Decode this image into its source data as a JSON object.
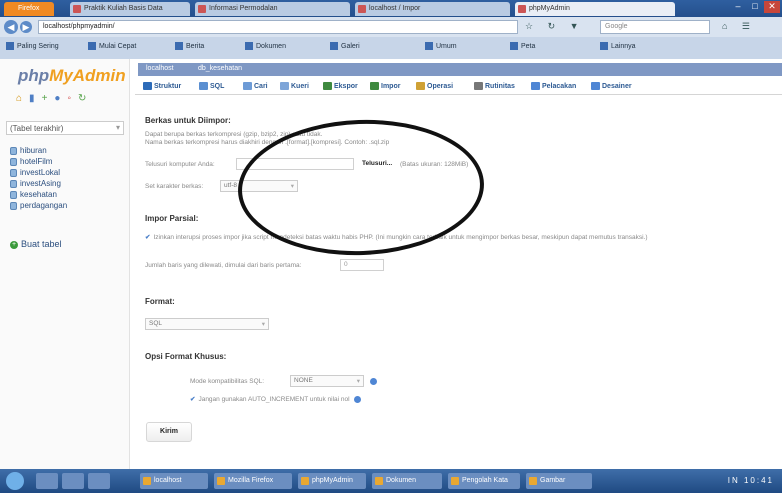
{
  "browser": {
    "tabs": [
      {
        "label": "Firefox",
        "style": "orange"
      },
      {
        "label": "Praktik Kuliah Basis Data",
        "style": "normal"
      },
      {
        "label": "Informasi Permodalan",
        "style": "normal"
      },
      {
        "label": "localhost / Impor",
        "style": "normal"
      },
      {
        "label": "phpMyAdmin",
        "style": "active"
      }
    ],
    "url": "localhost/phpmyadmin/",
    "search_placeholder": "Google",
    "bookmarks": [
      "Paling Sering",
      "Mulai Cepat",
      "Berita",
      "Dokumen",
      "Galeri",
      "Umum",
      "Peta",
      "Lainnya"
    ]
  },
  "pma": {
    "logo_pre": "php",
    "logo_my": "MyAdmin",
    "recent_label": "(Tabel terakhir)",
    "databases": [
      "hiburan",
      "hotelFilm",
      "investLokal",
      "investAsing",
      "kesehatan",
      "perdagangan"
    ],
    "new_table": "Buat tabel",
    "breadcrumb": [
      "localhost",
      "db_kesehatan"
    ],
    "menu": [
      {
        "label": "Struktur",
        "color": "#2d6bb8"
      },
      {
        "label": "SQL",
        "color": "#5b8fd1"
      },
      {
        "label": "Cari",
        "color": "#6d9bd6"
      },
      {
        "label": "Kueri",
        "color": "#7ea5d8"
      },
      {
        "label": "Ekspor",
        "color": "#3f8a3f"
      },
      {
        "label": "Impor",
        "color": "#3f8a3f"
      },
      {
        "label": "Operasi",
        "color": "#cfa135"
      },
      {
        "label": "Rutinitas",
        "color": "#777777"
      },
      {
        "label": "Pelacakan",
        "color": "#4f86d4"
      },
      {
        "label": "Desainer",
        "color": "#4f86d4"
      }
    ],
    "import": {
      "file_title": "Berkas untuk Diimpor:",
      "file_text_1": "Dapat berupa berkas terkompresi (gzip, bzip2, zip) atau tidak.",
      "file_text_2": "Nama berkas terkompresi harus diakhiri dengan .[format].[kompresi]. Contoh: .sql.zip",
      "browse_label": "Telusuri komputer Anda:",
      "browse_button": "Telusuri...",
      "max_size": "(Batas ukuran: 128MiB)",
      "charset_label": "Set karakter berkas:",
      "charset_value": "utf-8",
      "partial_title": "Impor Parsial:",
      "partial_check": "Izinkan interupsi proses impor jika script mendeteksi batas waktu habis PHP. (Ini mungkin cara terbaik untuk mengimpor berkas besar, meskipun dapat memutus transaksi.)",
      "skip_label": "Jumlah baris yang dilewati, dimulai dari baris pertama:",
      "skip_value": "0",
      "format_title": "Format:",
      "format_value": "SQL",
      "options_title": "Opsi Format Khusus:",
      "compat_label": "Mode kompatibilitas SQL:",
      "compat_value": "NONE",
      "auto_inc_check": "Jangan gunakan AUTO_INCREMENT untuk nilai nol",
      "go_button": "Kirim"
    }
  },
  "taskbar": {
    "items": [
      "localhost",
      "Mozilla Firefox",
      "phpMyAdmin",
      "Dokumen",
      "Pengolah Kata",
      "Gambar"
    ],
    "tray": "IN 10:41"
  }
}
